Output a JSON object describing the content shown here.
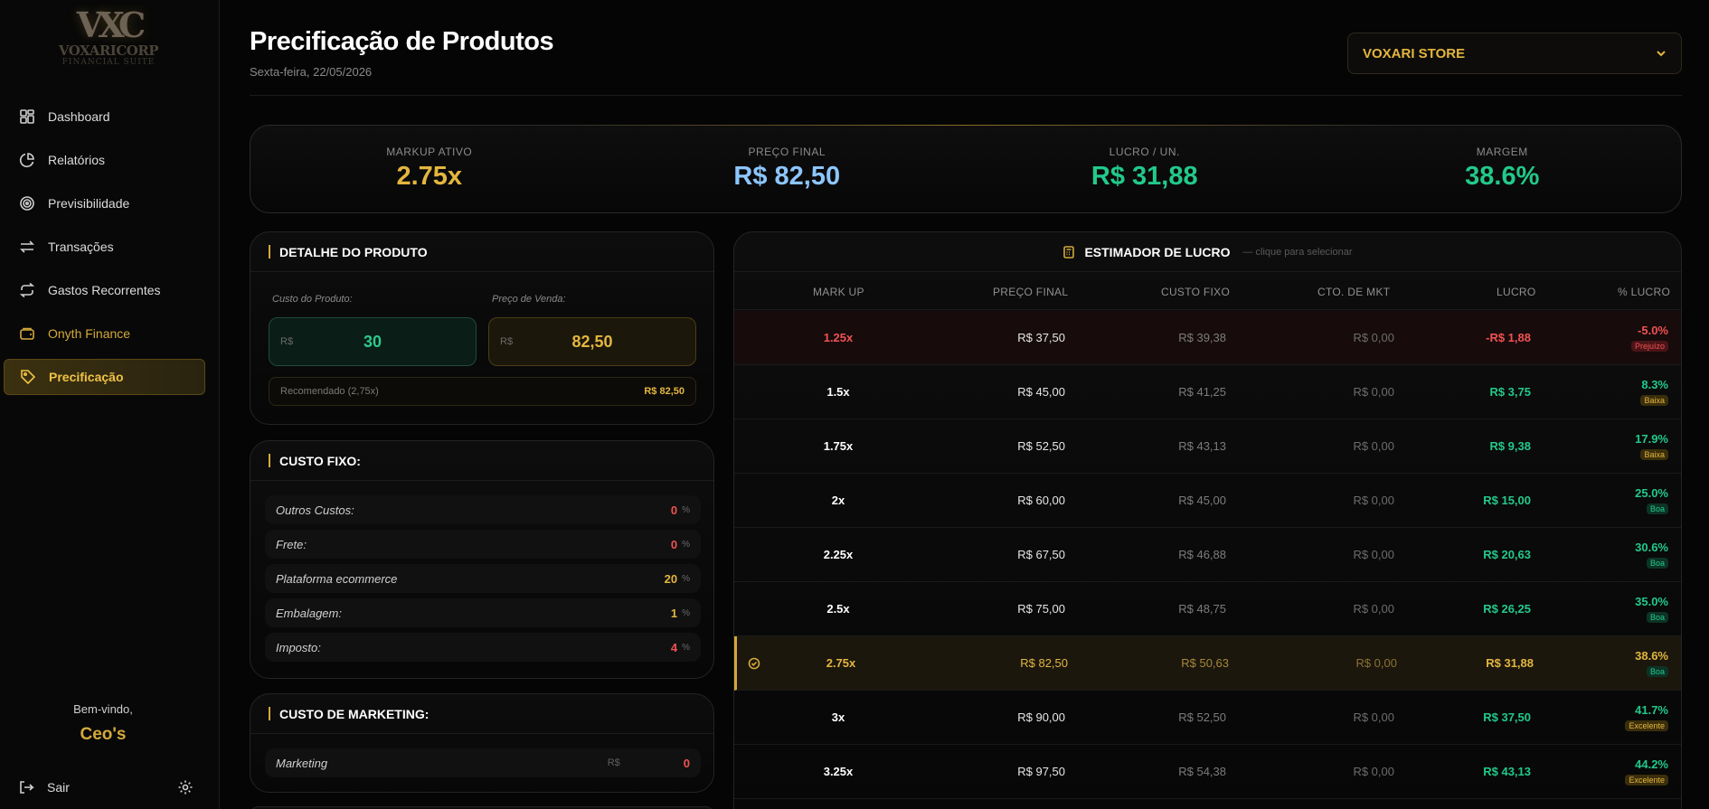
{
  "sidebar": {
    "logo": {
      "mark": "VXC",
      "name": "VOXARICORP",
      "sub": "FINANCIAL SUITE"
    },
    "items": [
      {
        "label": "Dashboard",
        "icon": "dashboard-grid-icon"
      },
      {
        "label": "Relatórios",
        "icon": "pie-chart-icon"
      },
      {
        "label": "Previsibilidade",
        "icon": "target-icon"
      },
      {
        "label": "Transações",
        "icon": "arrows-swap-icon"
      },
      {
        "label": "Gastos Recorrentes",
        "icon": "repeat-icon"
      },
      {
        "label": "Onyth Finance",
        "icon": "wallet-icon"
      },
      {
        "label": "Precificação",
        "icon": "tag-icon"
      }
    ],
    "welcome": "Bem-vindo,",
    "user": "Ceo's",
    "logout": "Sair"
  },
  "header": {
    "title": "Precificação de Produtos",
    "date": "Sexta-feira, 22/05/2026",
    "store": "VOXARI STORE"
  },
  "kpis": [
    {
      "label": "MARKUP ATIVO",
      "value": "2.75x",
      "color": "#e4b63f"
    },
    {
      "label": "PREÇO FINAL",
      "value": "R$ 82,50",
      "color": "#8cc6ff"
    },
    {
      "label": "LUCRO / UN.",
      "value": "R$ 31,88",
      "color": "#22c98b"
    },
    {
      "label": "MARGEM",
      "value": "38.6%",
      "color": "#22c98b"
    }
  ],
  "detail": {
    "title": "DETALHE DO PRODUTO",
    "cost_label": "Custo do Produto:",
    "price_label": "Preço de Venda:",
    "currency": "R$",
    "cost_value": "30",
    "price_value": "82,50",
    "recommended_label": "Recomendado (2,75x)",
    "recommended_value": "R$ 82,50"
  },
  "fixed_costs": {
    "title": "CUSTO FIXO:",
    "unit": "%",
    "rows": [
      {
        "name": "Outros Custos:",
        "value": "0",
        "color": "#f05252"
      },
      {
        "name": "Frete:",
        "value": "0",
        "color": "#f05252"
      },
      {
        "name": "Plataforma ecommerce",
        "value": "20",
        "color": "#e4b63f"
      },
      {
        "name": "Embalagem:",
        "value": "1",
        "color": "#e4b63f"
      },
      {
        "name": "Imposto:",
        "value": "4",
        "color": "#f05252"
      }
    ]
  },
  "marketing": {
    "title": "CUSTO DE MARKETING:",
    "row": {
      "name": "Marketing",
      "currency": "R$",
      "value": "0"
    }
  },
  "estimator": {
    "title": "ESTIMADOR DE LUCRO",
    "subtitle": "— clique para selecionar",
    "columns": [
      "MARK UP",
      "PREÇO FINAL",
      "CUSTO FIXO",
      "CTO. DE MKT",
      "LUCRO",
      "% LUCRO"
    ],
    "rows": [
      {
        "markup": "1.25x",
        "price": "R$ 37,50",
        "fixed": "R$ 39,38",
        "mkt": "R$ 0,00",
        "profit": "-R$ 1,88",
        "pct": "-5.0%",
        "badge": "Prejuízo",
        "state": "loss"
      },
      {
        "markup": "1.5x",
        "price": "R$ 45,00",
        "fixed": "R$ 41,25",
        "mkt": "R$ 0,00",
        "profit": "R$ 3,75",
        "pct": "8.3%",
        "badge": "Baixa",
        "state": "low"
      },
      {
        "markup": "1.75x",
        "price": "R$ 52,50",
        "fixed": "R$ 43,13",
        "mkt": "R$ 0,00",
        "profit": "R$ 9,38",
        "pct": "17.9%",
        "badge": "Baixa",
        "state": "low"
      },
      {
        "markup": "2x",
        "price": "R$ 60,00",
        "fixed": "R$ 45,00",
        "mkt": "R$ 0,00",
        "profit": "R$ 15,00",
        "pct": "25.0%",
        "badge": "Boa",
        "state": "good"
      },
      {
        "markup": "2.25x",
        "price": "R$ 67,50",
        "fixed": "R$ 46,88",
        "mkt": "R$ 0,00",
        "profit": "R$ 20,63",
        "pct": "30.6%",
        "badge": "Boa",
        "state": "good"
      },
      {
        "markup": "2.5x",
        "price": "R$ 75,00",
        "fixed": "R$ 48,75",
        "mkt": "R$ 0,00",
        "profit": "R$ 26,25",
        "pct": "35.0%",
        "badge": "Boa",
        "state": "good"
      },
      {
        "markup": "2.75x",
        "price": "R$ 82,50",
        "fixed": "R$ 50,63",
        "mkt": "R$ 0,00",
        "profit": "R$ 31,88",
        "pct": "38.6%",
        "badge": "Boa",
        "state": "selected"
      },
      {
        "markup": "3x",
        "price": "R$ 90,00",
        "fixed": "R$ 52,50",
        "mkt": "R$ 0,00",
        "profit": "R$ 37,50",
        "pct": "41.7%",
        "badge": "Excelente",
        "state": "excellent"
      },
      {
        "markup": "3.25x",
        "price": "R$ 97,50",
        "fixed": "R$ 54,38",
        "mkt": "R$ 0,00",
        "profit": "R$ 43,13",
        "pct": "44.2%",
        "badge": "Excelente",
        "state": "excellent"
      }
    ]
  },
  "colors": {
    "gold": "#d4a93c",
    "green": "#22c98b",
    "red": "#f05252",
    "blue": "#8cc6ff",
    "background": "#050505"
  }
}
